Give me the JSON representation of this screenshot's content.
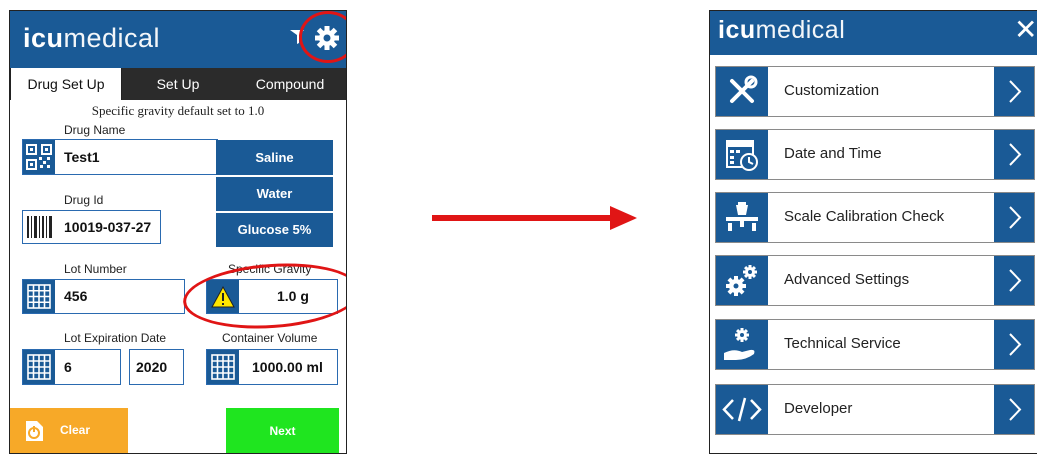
{
  "brand": {
    "bold": "icu",
    "light": "medical"
  },
  "left": {
    "tabs": [
      "Drug Set Up",
      "Set Up",
      "Compound"
    ],
    "notice": "Specific gravity default set to 1.0",
    "drug_name": {
      "label": "Drug Name",
      "value": "Test1"
    },
    "drug_id": {
      "label": "Drug Id",
      "value": "10019-037-27"
    },
    "presets": [
      "Saline",
      "Water",
      "Glucose 5%"
    ],
    "lot_number": {
      "label": "Lot Number",
      "value": "456"
    },
    "specific_gravity": {
      "label": "Specific Gravity",
      "value": "1.0 g"
    },
    "lot_expiration": {
      "label": "Lot Expiration Date",
      "month": "6",
      "year": "2020"
    },
    "container_volume": {
      "label": "Container Volume",
      "value": "1000.00 ml"
    },
    "clear_label": "Clear",
    "next_label": "Next"
  },
  "right": {
    "close": "✕",
    "menu": [
      {
        "label": "Customization",
        "icon": "tools-icon"
      },
      {
        "label": "Date and Time",
        "icon": "calendar-clock-icon"
      },
      {
        "label": "Scale Calibration Check",
        "icon": "scale-icon"
      },
      {
        "label": "Advanced Settings",
        "icon": "gears-icon"
      },
      {
        "label": "Technical Service",
        "icon": "hand-gear-icon"
      },
      {
        "label": "Developer",
        "icon": "code-icon"
      }
    ]
  },
  "colors": {
    "brand_blue": "#1a5a96",
    "highlight_red": "#e01515",
    "clear_orange": "#f7a928",
    "next_green": "#1fe51f"
  }
}
